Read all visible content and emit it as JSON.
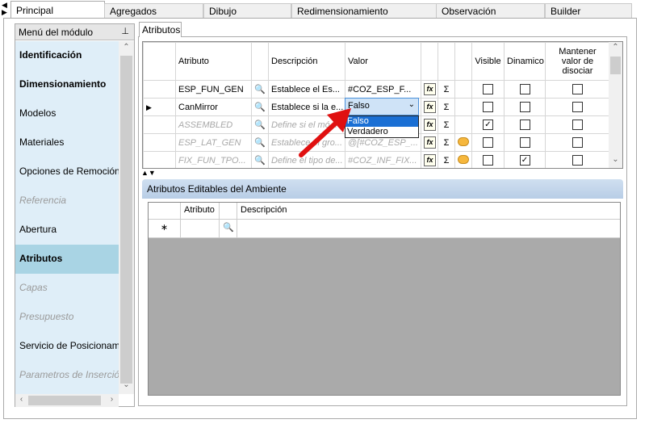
{
  "main_tabs": [
    "Principal",
    "Agregados",
    "Dibujo",
    "Redimensionamiento",
    "Observación",
    "Builder"
  ],
  "sidebar": {
    "header": "Menú del módulo",
    "items": [
      {
        "label": "Identificación",
        "style": "bold"
      },
      {
        "label": "Dimensionamiento",
        "style": "bold"
      },
      {
        "label": "Modelos",
        "style": "normal"
      },
      {
        "label": "Materiales",
        "style": "normal"
      },
      {
        "label": "Opciones de Remoción",
        "style": "normal"
      },
      {
        "label": "Referencia",
        "style": "disabled"
      },
      {
        "label": "Abertura",
        "style": "normal"
      },
      {
        "label": "Atributos",
        "style": "selected"
      },
      {
        "label": "Capas",
        "style": "disabled"
      },
      {
        "label": "Presupuesto",
        "style": "disabled"
      },
      {
        "label": "Servicio de Posicionamiento",
        "style": "normal"
      },
      {
        "label": "Parametros de Inserción",
        "style": "disabled"
      }
    ]
  },
  "content_tab": "Atributos",
  "grid": {
    "headers": {
      "atributo": "Atributo",
      "descripcion": "Descripción",
      "valor": "Valor",
      "visible": "Visible",
      "dinamico": "Dinamico",
      "mantener": "Mantener valor de disociar"
    },
    "rows": [
      {
        "atributo": "ESP_FUN_GEN",
        "descripcion": "Establece el Es...",
        "valor": "#COZ_ESP_F...",
        "dim": false,
        "chat": false,
        "visible": false,
        "dinamico": false,
        "mantener": false,
        "current": false
      },
      {
        "atributo": "CanMirror",
        "descripcion": "Establece si la e...",
        "valor": "Falso",
        "dim": false,
        "chat": false,
        "visible": false,
        "dinamico": false,
        "mantener": false,
        "current": true
      },
      {
        "atributo": "ASSEMBLED",
        "descripcion": "Define si el mó...",
        "valor": "",
        "dim": true,
        "chat": false,
        "visible": true,
        "dinamico": false,
        "mantener": false,
        "current": false
      },
      {
        "atributo": "ESP_LAT_GEN",
        "descripcion": "Establece el gro...",
        "valor": "@[#COZ_ESP_...",
        "dim": true,
        "chat": true,
        "visible": false,
        "dinamico": false,
        "mantener": false,
        "current": false
      },
      {
        "atributo": "FIX_FUN_TPO...",
        "descripcion": "Define el tipo de...",
        "valor": "#COZ_INF_FIX...",
        "dim": true,
        "chat": true,
        "visible": false,
        "dinamico": true,
        "mantener": false,
        "current": false
      }
    ],
    "sigma": "Σ",
    "fx_label": "fx"
  },
  "dropdown": {
    "options": [
      "Falso",
      "Verdadero"
    ],
    "selected": "Falso"
  },
  "ambiente": {
    "title": "Atributos Editables del Ambiente",
    "headers": {
      "atributo": "Atributo",
      "descripcion": "Descripción"
    },
    "new_row_marker": "∗"
  },
  "colors": {
    "sidebar_bg": "#dfeef8",
    "sidebar_selected": "#a9d4e4",
    "dropdown_selected": "#1a6fd4",
    "annotation_arrow": "#e01010"
  }
}
